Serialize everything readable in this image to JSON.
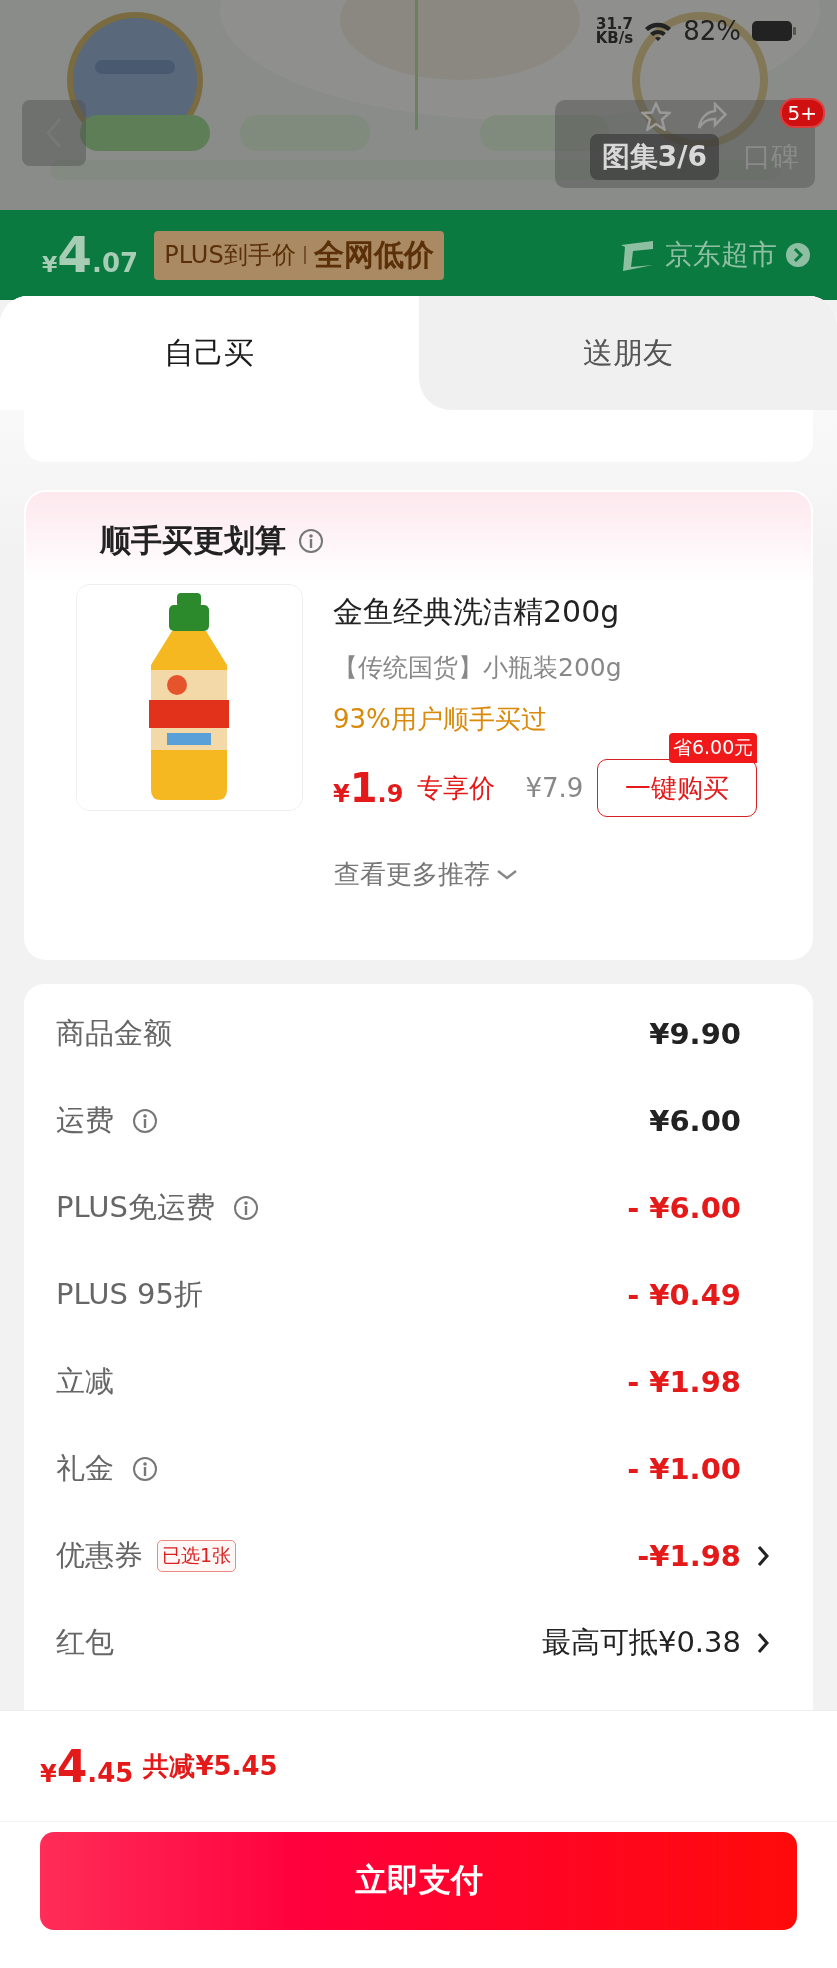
{
  "status_bar": {
    "speed": "31.7",
    "speed_unit": "KB/s",
    "battery": "82%"
  },
  "gallery": {
    "badge": "5+",
    "tabs": [
      {
        "label": "图集3/6",
        "selected": true
      },
      {
        "label": "口碑",
        "selected": false
      }
    ]
  },
  "price_banner": {
    "currency": "¥",
    "integer": "4",
    "decimal": ".07",
    "tag_left": "PLUS到手价",
    "tag_right": "全网低价",
    "store": "京东超市"
  },
  "tabs": [
    {
      "label": "自己买",
      "selected": true
    },
    {
      "label": "送朋友",
      "selected": false
    }
  ],
  "recommend": {
    "title": "顺手买更划算",
    "product": {
      "name": "金鱼经典洗洁精200g",
      "subtitle": "【传统国货】小瓶装200g",
      "social": "93%用户顺手买过",
      "currency": "¥",
      "integer": "1",
      "decimal": ".9",
      "price_label": "专享价",
      "original_price": "¥7.9",
      "buy_button": "一键购买",
      "saving_badge": "省6.00元"
    },
    "more": "查看更多推荐"
  },
  "costs": [
    {
      "label": "商品金额",
      "info": false,
      "value": "¥9.90",
      "kind": "normal",
      "arrow": false
    },
    {
      "label": "运费",
      "info": true,
      "value": "¥6.00",
      "kind": "normal",
      "arrow": false
    },
    {
      "label": "PLUS免运费",
      "info": true,
      "value": "- ¥6.00",
      "kind": "discount",
      "arrow": false
    },
    {
      "label": "PLUS 95折",
      "info": false,
      "value": "- ¥0.49",
      "kind": "discount",
      "arrow": false
    },
    {
      "label": "立减",
      "info": false,
      "value": "- ¥1.98",
      "kind": "discount",
      "arrow": false
    },
    {
      "label": "礼金",
      "info": true,
      "value": "- ¥1.00",
      "kind": "discount",
      "arrow": false
    },
    {
      "label": "优惠券",
      "info": false,
      "tag": "已选1张",
      "value": "-¥1.98",
      "kind": "discount",
      "arrow": true
    },
    {
      "label": "红包",
      "info": false,
      "value": "最高可抵¥0.38",
      "kind": "normal",
      "arrow": true
    }
  ],
  "footer": {
    "currency": "¥",
    "integer": "4",
    "decimal": ".45",
    "saving": "共减¥5.45"
  },
  "pay_button": "立即支付"
}
